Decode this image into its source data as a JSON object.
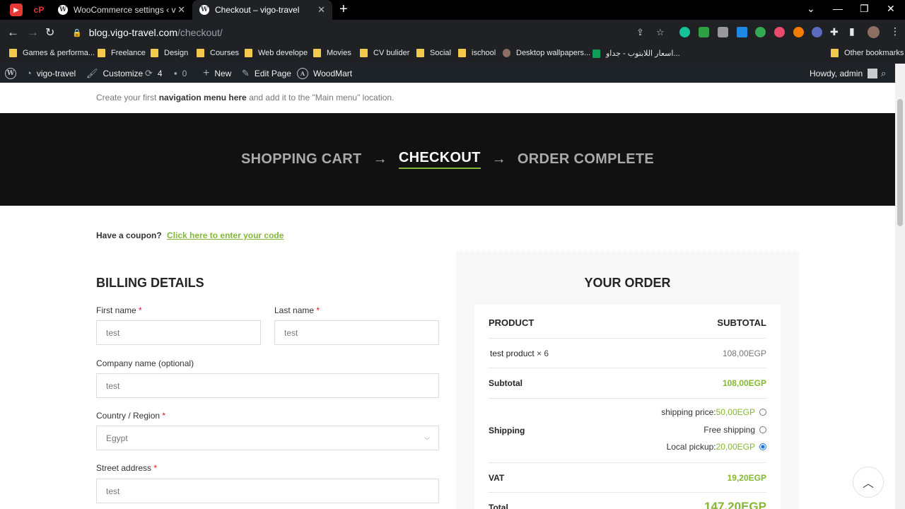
{
  "browser": {
    "tabs": [
      {
        "title": "WooCommerce settings ‹ vigo-tr",
        "active": false
      },
      {
        "title": "Checkout – vigo-travel",
        "active": true
      }
    ],
    "url_host": "blog.vigo-travel.com",
    "url_path": "/checkout/",
    "bookmarks": [
      "Games & performa...",
      "Freelance",
      "Design",
      "Courses",
      "Web develope",
      "Movies",
      "CV bulider",
      "Social",
      "ischool",
      "Desktop wallpapers...",
      "اسعار اللابتوب - جداو...",
      "Other bookmarks"
    ]
  },
  "adminbar": {
    "site": "vigo-travel",
    "customize": "Customize",
    "updates": "4",
    "comments": "0",
    "new": "New",
    "edit": "Edit Page",
    "theme": "WoodMart",
    "howdy": "Howdy, admin"
  },
  "notice": {
    "before": "Create your first ",
    "link": "navigation menu here",
    "after": " and add it to the \"Main menu\" location."
  },
  "steps": {
    "cart": "SHOPPING CART",
    "checkout": "CHECKOUT",
    "complete": "ORDER COMPLETE",
    "arrow": "→"
  },
  "coupon": {
    "question": "Have a coupon?",
    "link": "Click here to enter your code"
  },
  "billing": {
    "title": "BILLING DETAILS",
    "first_name_label": "First name",
    "first_name_value": "test",
    "last_name_label": "Last name",
    "last_name_value": "test",
    "company_label": "Company name (optional)",
    "company_value": "test",
    "country_label": "Country / Region",
    "country_value": "Egypt",
    "street_label": "Street address",
    "street_value": "test",
    "required_mark": "*"
  },
  "order": {
    "title": "YOUR ORDER",
    "col_product": "PRODUCT",
    "col_subtotal": "SUBTOTAL",
    "item_name": "test product",
    "item_qty": "× 6",
    "item_total": "108,00EGP",
    "subtotal_label": "Subtotal",
    "subtotal_value": "108,00EGP",
    "shipping_label": "Shipping",
    "shipping_options": [
      {
        "label": "shipping price: ",
        "price": "50,00EGP",
        "selected": false
      },
      {
        "label": "Free shipping",
        "price": "",
        "selected": false
      },
      {
        "label": "Local pickup: ",
        "price": "20,00EGP",
        "selected": true
      }
    ],
    "vat_label": "VAT",
    "vat_value": "19,20EGP",
    "total_label": "Total",
    "total_value": "147,20EGP"
  },
  "colors": {
    "accent": "#83b735",
    "hero_bg": "#111111",
    "adminbar_bg": "#1d2327",
    "required": "#e01020"
  }
}
